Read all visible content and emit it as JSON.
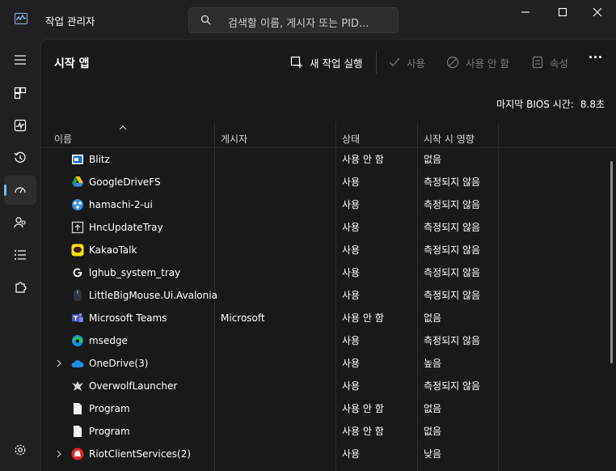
{
  "app": {
    "title": "작업 관리자"
  },
  "search": {
    "placeholder": "검색할 이름, 게시자 또는 PID..."
  },
  "page": {
    "title": "시작 앱"
  },
  "toolbar": {
    "new_task": "새 작업 실행",
    "enable": "사용",
    "disable": "사용 안 함",
    "properties": "속성"
  },
  "bios": {
    "label": "마지막 BIOS 시간:",
    "value": "8.8초"
  },
  "table": {
    "columns": [
      "이름",
      "게시자",
      "상태",
      "시작 시 영향"
    ],
    "rows": [
      {
        "name": "Blitz",
        "publisher": "",
        "status": "사용 안 함",
        "impact": "없음",
        "icon": "blitz-icon",
        "expandable": false
      },
      {
        "name": "GoogleDriveFS",
        "publisher": "",
        "status": "사용",
        "impact": "측정되지 않음",
        "icon": "google-drive-icon",
        "expandable": false
      },
      {
        "name": "hamachi-2-ui",
        "publisher": "",
        "status": "사용",
        "impact": "측정되지 않음",
        "icon": "hamachi-icon",
        "expandable": false
      },
      {
        "name": "HncUpdateTray",
        "publisher": "",
        "status": "사용",
        "impact": "측정되지 않음",
        "icon": "hnc-update-icon",
        "expandable": false
      },
      {
        "name": "KakaoTalk",
        "publisher": "",
        "status": "사용",
        "impact": "측정되지 않음",
        "icon": "kakaotalk-icon",
        "expandable": false
      },
      {
        "name": "lghub_system_tray",
        "publisher": "",
        "status": "사용",
        "impact": "측정되지 않음",
        "icon": "logitech-g-icon",
        "expandable": false
      },
      {
        "name": "LittleBigMouse.Ui.Avalonia",
        "publisher": "",
        "status": "사용",
        "impact": "측정되지 않음",
        "icon": "littlebigmouse-icon",
        "expandable": false
      },
      {
        "name": "Microsoft Teams",
        "publisher": "Microsoft",
        "status": "사용 안 함",
        "impact": "없음",
        "icon": "teams-icon",
        "expandable": false
      },
      {
        "name": "msedge",
        "publisher": "",
        "status": "사용",
        "impact": "측정되지 않음",
        "icon": "edge-icon",
        "expandable": false
      },
      {
        "name": "OneDrive(3)",
        "publisher": "",
        "status": "사용",
        "impact": "높음",
        "icon": "onedrive-icon",
        "expandable": true
      },
      {
        "name": "OverwolfLauncher",
        "publisher": "",
        "status": "사용",
        "impact": "측정되지 않음",
        "icon": "overwolf-icon",
        "expandable": false
      },
      {
        "name": "Program",
        "publisher": "",
        "status": "사용 안 함",
        "impact": "없음",
        "icon": "file-icon",
        "expandable": false
      },
      {
        "name": "Program",
        "publisher": "",
        "status": "사용 안 함",
        "impact": "없음",
        "icon": "file-icon",
        "expandable": false
      },
      {
        "name": "RiotClientServices(2)",
        "publisher": "",
        "status": "사용",
        "impact": "낮음",
        "icon": "riot-icon",
        "expandable": true
      }
    ]
  },
  "colors": {
    "background": "#202020",
    "panel": "#191919",
    "accent": "#76b9ed",
    "text": "#ffffff",
    "disabled": "#7a7a7a"
  }
}
